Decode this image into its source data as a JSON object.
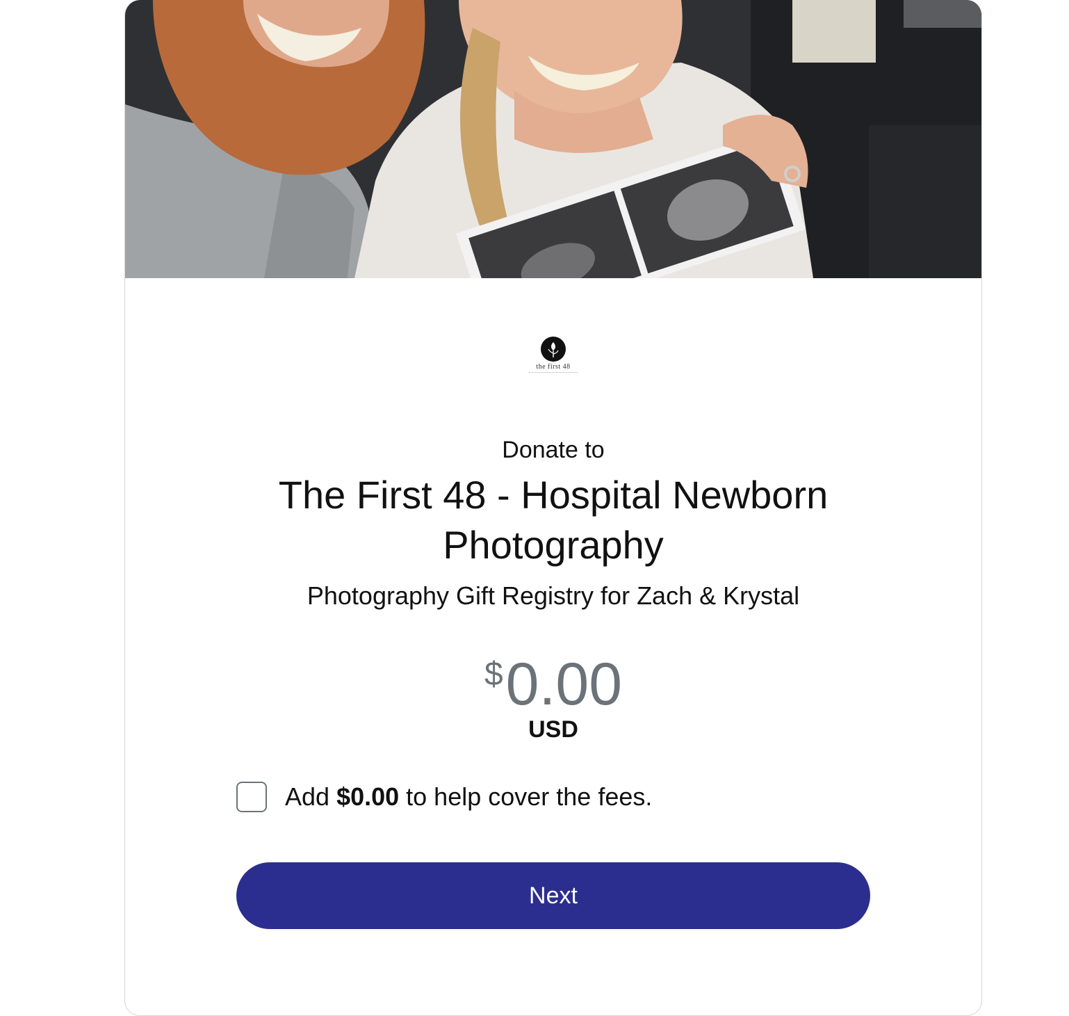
{
  "hero": {
    "image_description_icon": "hero-photo"
  },
  "logo": {
    "text": "the first 48"
  },
  "header": {
    "donate_to": "Donate to",
    "org_name": "The First 48 - Hospital Newborn Photography",
    "purpose": "Photography Gift Registry for Zach & Krystal"
  },
  "amount": {
    "symbol": "$",
    "value": "0.00",
    "currency": "USD"
  },
  "fees": {
    "checked": false,
    "prefix": "Add ",
    "amount": "$0.00",
    "suffix": " to help cover the fees."
  },
  "actions": {
    "next_label": "Next"
  },
  "colors": {
    "button": "#2c2e8f",
    "amount": "#6c7378",
    "border": "#d6d6d6"
  }
}
